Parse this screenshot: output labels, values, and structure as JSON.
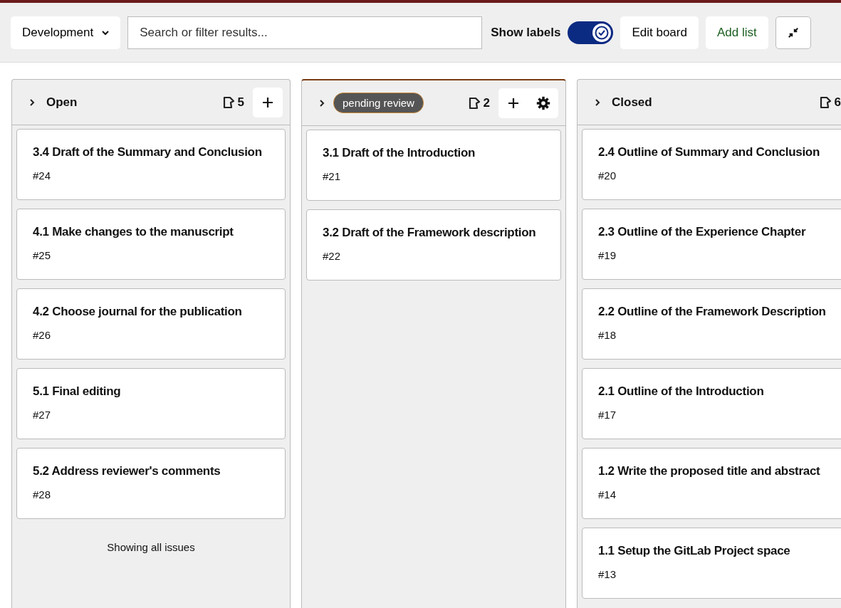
{
  "toolbar": {
    "board_switcher": "Development",
    "search": {
      "placeholder": "Search or filter results..."
    },
    "show_labels": {
      "label": "Show labels",
      "on": true
    },
    "buttons": [
      {
        "kind": "text",
        "label": "Edit board"
      },
      {
        "kind": "accent",
        "label": "Add list"
      },
      {
        "kind": "icon"
      }
    ]
  },
  "lists": [
    {
      "kind": "plain",
      "title": "Open",
      "count": "5",
      "tools": [
        {
          "kind": "add"
        }
      ],
      "footer": "Showing all issues",
      "cards": [
        {
          "title": "3.4 Draft of the Summary and Conclusion",
          "number": "#24"
        },
        {
          "title": "4.1 Make changes to the manuscript",
          "number": "#25"
        },
        {
          "title": "4.2 Choose journal for the publication",
          "number": "#26"
        },
        {
          "title": "5.1 Final editing",
          "number": "#27"
        },
        {
          "title": "5.2 Address reviewer's comments",
          "number": "#28"
        }
      ]
    },
    {
      "kind": "label",
      "title": "pending review",
      "count": "2",
      "tools": [
        {
          "kind": "add"
        },
        {
          "kind": "settings"
        }
      ],
      "cards": [
        {
          "title": "3.1 Draft of the Introduction",
          "number": "#21"
        },
        {
          "title": "3.2 Draft of the Framework description",
          "number": "#22"
        }
      ]
    },
    {
      "kind": "plain",
      "title": "Closed",
      "count": "6",
      "cards": [
        {
          "title": "2.4 Outline of Summary and Conclusion",
          "number": "#20"
        },
        {
          "title": "2.3 Outline of the Experience Chapter",
          "number": "#19"
        },
        {
          "title": "2.2 Outline of the Framework Description",
          "number": "#18"
        },
        {
          "title": "2.1 Outline of the Introduction",
          "number": "#17"
        },
        {
          "title": "1.2 Write the proposed title and abstract",
          "number": "#14"
        },
        {
          "title": "1.1 Setup the GitLab Project space",
          "number": "#13"
        }
      ]
    }
  ]
}
